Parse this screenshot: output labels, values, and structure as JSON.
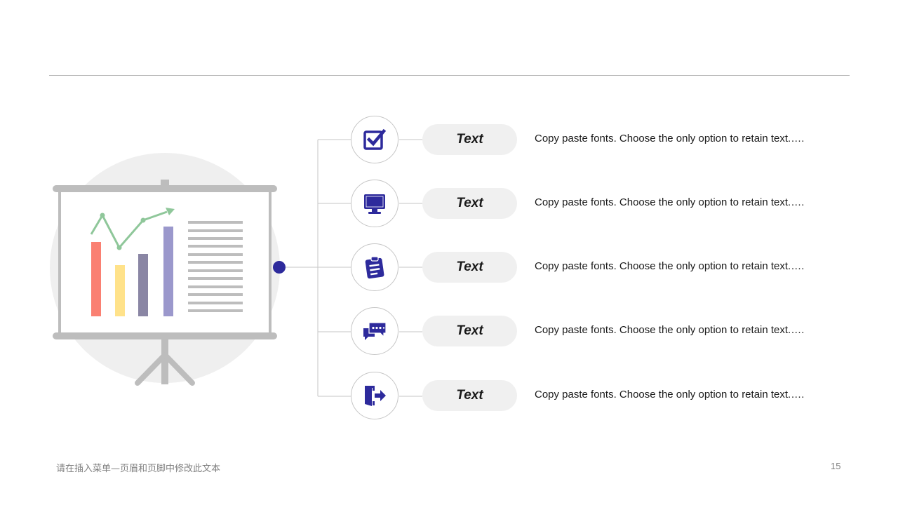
{
  "rows": [
    {
      "pill": "Text",
      "description": "Copy paste fonts. Choose the only option to retain text.….",
      "icon": "checkbox-icon"
    },
    {
      "pill": "Text",
      "description": "Copy paste fonts. Choose the only option to retain text.….",
      "icon": "monitor-icon"
    },
    {
      "pill": "Text",
      "description": "Copy paste fonts. Choose the only option to retain text.….",
      "icon": "clipboard-icon"
    },
    {
      "pill": "Text",
      "description": "Copy paste fonts. Choose the only option to retain text.….",
      "icon": "chat-bubbles-icon"
    },
    {
      "pill": "Text",
      "description": "Copy paste fonts. Choose the only option to retain text.….",
      "icon": "exit-door-icon"
    }
  ],
  "footer": {
    "text": "请在插入菜单—页眉和页脚中修改此文本",
    "page_number": "15"
  },
  "colors": {
    "accent": "#2d2a9c",
    "bar_red": "#fa8072",
    "bar_yellow": "#ffe28a",
    "bar_slate": "#8a86a4",
    "bar_lavender": "#9b98cc",
    "trend_line": "#8fc79a"
  }
}
